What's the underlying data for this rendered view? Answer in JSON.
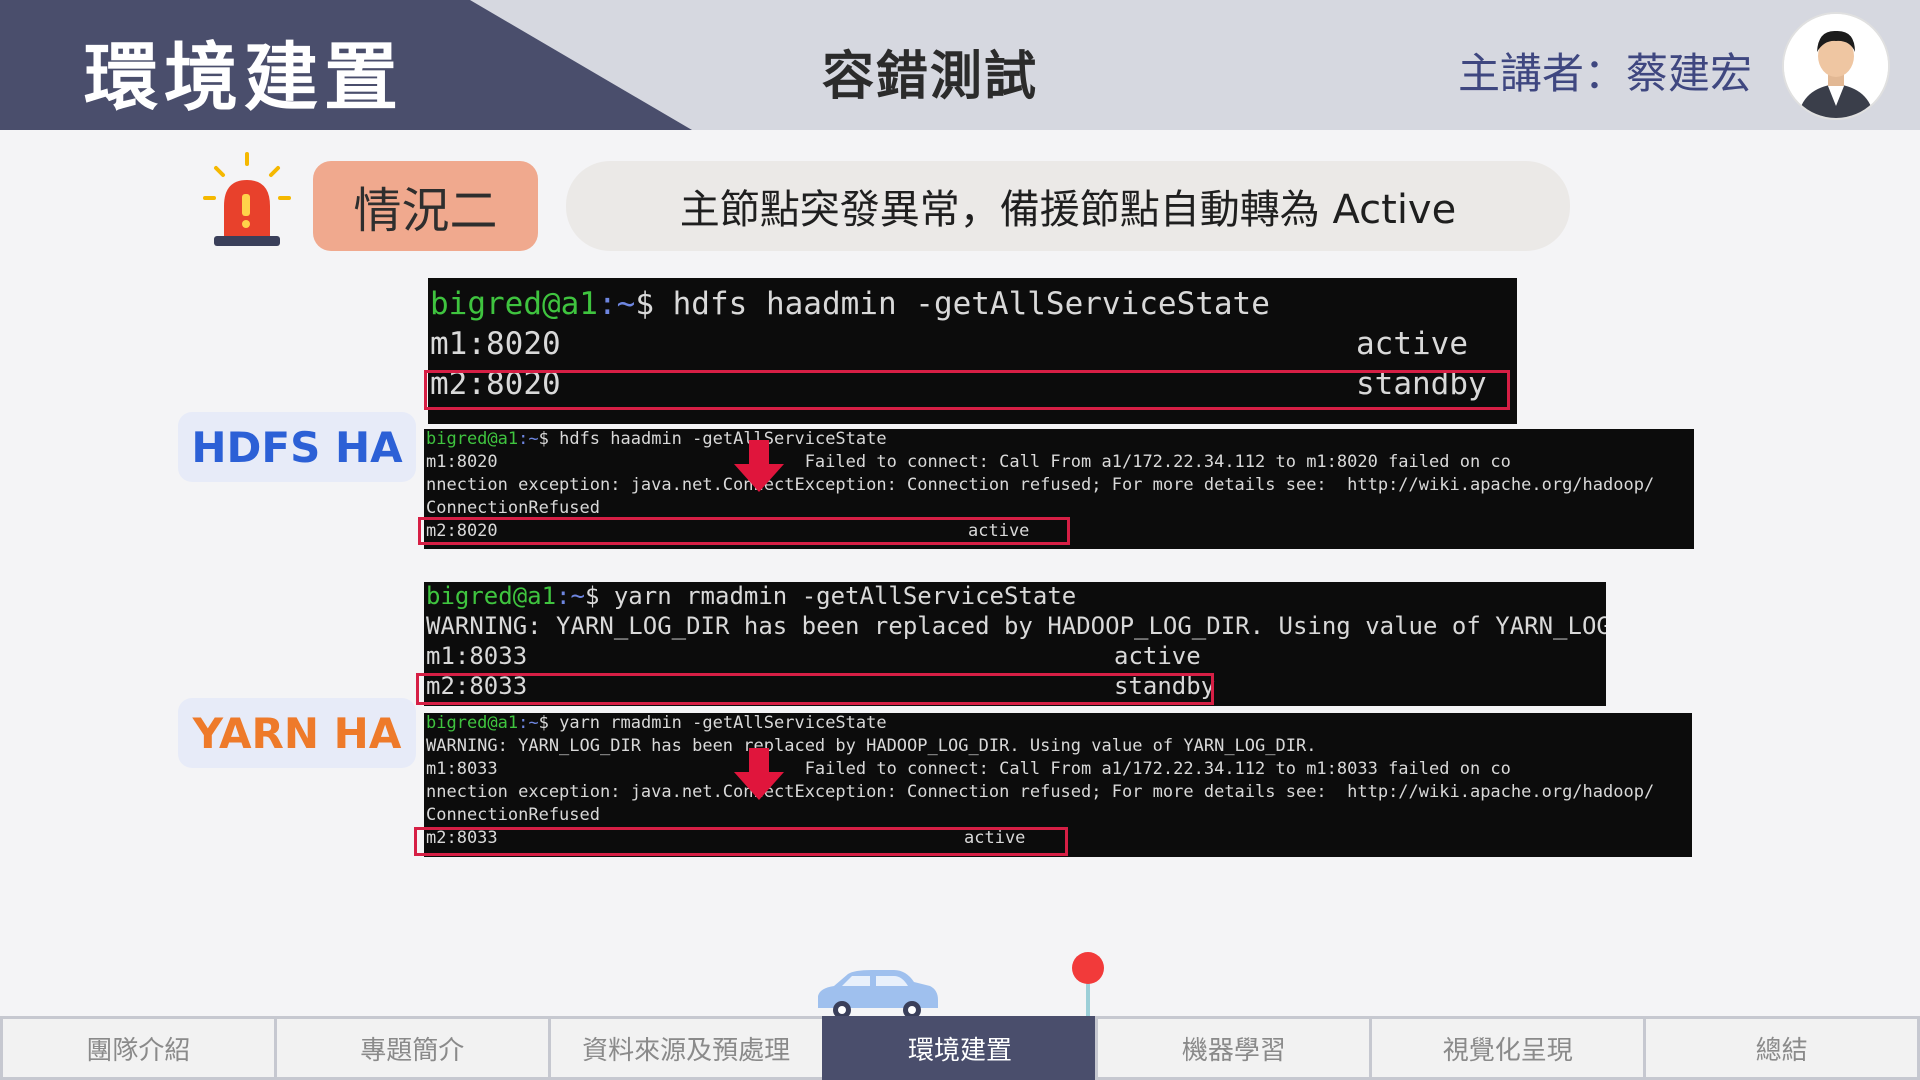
{
  "header": {
    "section_title": "環境建置",
    "page_title": "容錯測試",
    "presenter": "主講者：蔡建宏"
  },
  "scenario": {
    "badge": "情況二",
    "description": "主節點突發異常，備援節點自動轉為 Active"
  },
  "labels": {
    "hdfs": "HDFS HA",
    "yarn": "YARN HA"
  },
  "terminals": {
    "hdfs_before": {
      "prompt_user": "bigred@a1",
      "prompt_path": ":~",
      "prompt_symbol": "$",
      "command": " hdfs haadmin -getAllServiceState",
      "rows": [
        {
          "host": "m1:8020",
          "state": "active"
        },
        {
          "host": "m2:8020",
          "state": "standby"
        }
      ]
    },
    "hdfs_after": {
      "prompt_user": "bigred@a1",
      "prompt_path": ":~",
      "prompt_symbol": "$",
      "command": " hdfs haadmin -getAllServiceState",
      "line2": "m1:8020                              Failed to connect: Call From a1/172.22.34.112 to m1:8020 failed on co",
      "line3": "nnection exception: java.net.ConnectException: Connection refused; For more details see:  http://wiki.apache.org/hadoop/",
      "line4": "ConnectionRefused",
      "last_host": "m2:8020",
      "last_state": "active"
    },
    "yarn_before": {
      "prompt_user": "bigred@a1",
      "prompt_path": ":~",
      "prompt_symbol": "$",
      "command": " yarn rmadmin -getAllServiceState",
      "warning": "WARNING: YARN_LOG_DIR has been replaced by HADOOP_LOG_DIR. Using value of YARN_LOG_DIR.",
      "rows": [
        {
          "host": "m1:8033",
          "state": "active"
        },
        {
          "host": "m2:8033",
          "state": "standby"
        }
      ]
    },
    "yarn_after": {
      "prompt_user": "bigred@a1",
      "prompt_path": ":~",
      "prompt_symbol": "$",
      "command": " yarn rmadmin -getAllServiceState",
      "warning": "WARNING: YARN_LOG_DIR has been replaced by HADOOP_LOG_DIR. Using value of YARN_LOG_DIR.",
      "line3": "m1:8033                              Failed to connect: Call From a1/172.22.34.112 to m1:8033 failed on co",
      "line4": "nnection exception: java.net.ConnectException: Connection refused; For more details see:  http://wiki.apache.org/hadoop/",
      "line5": "ConnectionRefused",
      "last_host": "m2:8033",
      "last_state": "active"
    }
  },
  "nav": {
    "items": [
      "團隊介紹",
      "專題簡介",
      "資料來源及預處理",
      "環境建置",
      "機器學習",
      "視覺化呈現",
      "總結"
    ],
    "active_index": 3
  },
  "colors": {
    "header_dark": "#4a4e6c",
    "highlight": "#d61f45",
    "hdfs_label": "#2c60d6",
    "yarn_label": "#ee7a2a",
    "badge": "#f0a98e"
  }
}
